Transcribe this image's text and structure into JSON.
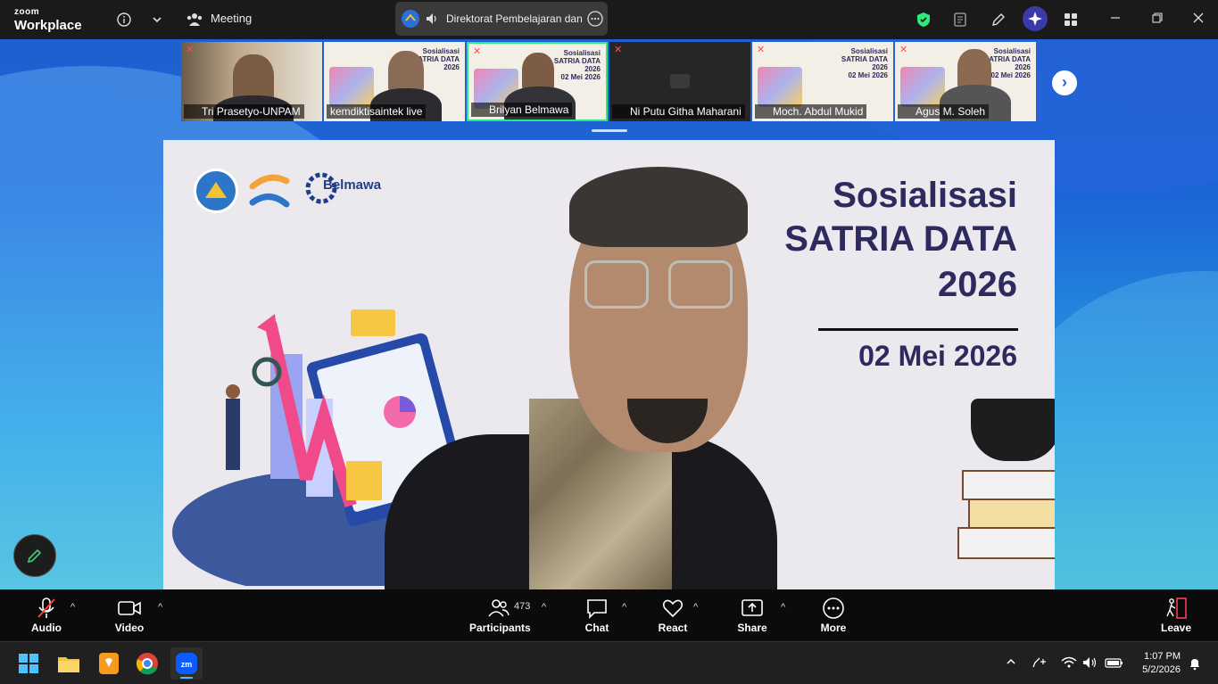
{
  "app": {
    "logo_line1": "zoom",
    "logo_line2": "Workplace"
  },
  "titlebar": {
    "meeting_label": "Meeting",
    "meeting_title": "Direktorat Pembelajaran dan",
    "shield_color": "#2ee87a"
  },
  "gallery": [
    {
      "name": "Tri Prasetyo-UNPAM",
      "muted": true,
      "active": false
    },
    {
      "name": "kemdiktisaintek live",
      "muted": false,
      "active": false
    },
    {
      "name": "Brilyan Belmawa",
      "muted": true,
      "active": true
    },
    {
      "name": "Ni Putu Githa Maharani",
      "muted": true,
      "active": false
    },
    {
      "name": "Moch. Abdul Mukid",
      "muted": true,
      "active": false
    },
    {
      "name": "Agus M. Soleh",
      "muted": true,
      "active": false
    }
  ],
  "mini_slide": {
    "line1": "Sosialisasi",
    "line2": "SATRIA DATA",
    "line3": "2026",
    "line4": "02 Mei 2026"
  },
  "main_slide": {
    "title_line1": "Sosialisasi",
    "title_line2": "SATRIA DATA",
    "title_line3": "2026",
    "date": "02 Mei 2026",
    "logo_text": "Belmawa"
  },
  "toolbar": {
    "audio": "Audio",
    "video": "Video",
    "participants": "Participants",
    "participants_count": "473",
    "chat": "Chat",
    "react": "React",
    "share": "Share",
    "more": "More",
    "leave": "Leave"
  },
  "taskbar": {
    "time": "1:07 PM",
    "date": "5/2/2026"
  }
}
